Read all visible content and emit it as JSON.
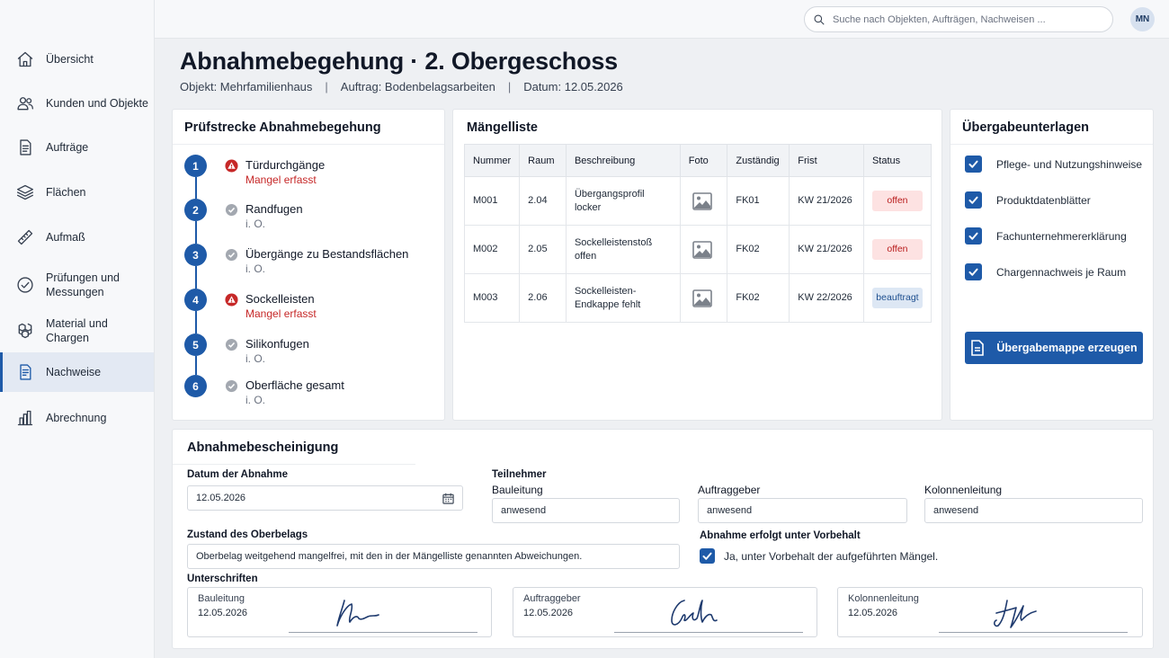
{
  "sidebar": {
    "items": [
      {
        "label": "Übersicht",
        "icon": "home-icon"
      },
      {
        "label": "Kunden und Objekte",
        "icon": "users-icon"
      },
      {
        "label": "Aufträge",
        "icon": "document-icon"
      },
      {
        "label": "Flächen",
        "icon": "layers-icon"
      },
      {
        "label": "Aufmaß",
        "icon": "ruler-icon"
      },
      {
        "label": "Prüfungen und Messungen",
        "icon": "check-circle-icon"
      },
      {
        "label": "Material und Chargen",
        "icon": "boxes-icon"
      },
      {
        "label": "Nachweise",
        "icon": "certificate-icon",
        "active": true
      },
      {
        "label": "Abrechnung",
        "icon": "bar-chart-icon"
      }
    ]
  },
  "topbar": {
    "search_placeholder": "Suche nach Objekten, Aufträgen, Nachweisen ...",
    "avatar_initials": "MN"
  },
  "header": {
    "title": "Abnahmebegehung · 2. Obergeschoss",
    "meta": [
      "Objekt: Mehrfamilienhaus",
      "Auftrag: Bodenbelagsarbeiten",
      "Datum: 12.05.2026"
    ],
    "separator": "|"
  },
  "steps_card": {
    "title": "Prüfstrecke Abnahmebegehung",
    "steps": [
      {
        "number": "1",
        "label": "Türdurchgänge",
        "status": "Mangel erfasst",
        "defect": true
      },
      {
        "number": "2",
        "label": "Randfugen",
        "status": "i. O.",
        "defect": false
      },
      {
        "number": "3",
        "label": "Übergänge zu Bestandsflächen",
        "status": "i. O.",
        "defect": false
      },
      {
        "number": "4",
        "label": "Sockelleisten",
        "status": "Mangel erfasst",
        "defect": true
      },
      {
        "number": "5",
        "label": "Silikonfugen",
        "status": "i. O.",
        "defect": false
      },
      {
        "number": "6",
        "label": "Oberfläche gesamt",
        "status": "i. O.",
        "defect": false
      }
    ]
  },
  "defects_card": {
    "title": "Mängelliste",
    "columns": [
      "Nummer",
      "Raum",
      "Beschreibung",
      "Foto",
      "Zuständig",
      "Frist",
      "Status"
    ],
    "rows": [
      {
        "nummer": "M001",
        "raum": "2.04",
        "beschreibung": "Übergangsprofil locker",
        "zustaendig": "FK01",
        "frist": "KW 21/2026",
        "status": "offen",
        "status_type": "offen"
      },
      {
        "nummer": "M002",
        "raum": "2.05",
        "beschreibung": "Sockelleistenstoß offen",
        "zustaendig": "FK02",
        "frist": "KW 21/2026",
        "status": "offen",
        "status_type": "offen"
      },
      {
        "nummer": "M003",
        "raum": "2.06",
        "beschreibung": "Sockelleisten-Endkappe fehlt",
        "zustaendig": "FK02",
        "frist": "KW 22/2026",
        "status": "beauftragt",
        "status_type": "beauftragt"
      }
    ]
  },
  "docs_card": {
    "title": "Übergabeunterlagen",
    "items": [
      {
        "label": "Pflege- und Nutzungshinweise",
        "checked": true
      },
      {
        "label": "Produktdatenblätter",
        "checked": true
      },
      {
        "label": "Fachunternehmererklärung",
        "checked": true
      },
      {
        "label": "Chargennachweis je Raum",
        "checked": true
      }
    ],
    "button_label": "Übergabemappe erzeugen"
  },
  "certificate": {
    "title": "Abnahmebescheinigung",
    "date_label": "Datum der Abnahme",
    "date_value": "12.05.2026",
    "participants_label": "Teilnehmer",
    "participants": [
      {
        "role": "Bauleitung",
        "value": "anwesend"
      },
      {
        "role": "Auftraggeber",
        "value": "anwesend"
      },
      {
        "role": "Kolonnenleitung",
        "value": "anwesend"
      }
    ],
    "condition_label": "Zustand des Oberbelags",
    "condition_value": "Oberbelag weitgehend mangelfrei, mit den in der Mängelliste genannten Abweichungen.",
    "reservation_label": "Abnahme erfolgt unter Vorbehalt",
    "reservation_option": "Ja, unter Vorbehalt der aufgeführten Mängel.",
    "reservation_checked": true,
    "signatures_label": "Unterschriften",
    "signatures": [
      {
        "role": "Bauleitung",
        "date": "12.05.2026"
      },
      {
        "role": "Auftraggeber",
        "date": "12.05.2026"
      },
      {
        "role": "Kolonnenleitung",
        "date": "12.05.2026"
      }
    ]
  },
  "colors": {
    "primary": "#1e5aa8",
    "defect": "#c62828",
    "ok": "#9ca3af",
    "badge_open_bg": "#fde2e2",
    "badge_assigned_bg": "#dde7f4"
  }
}
